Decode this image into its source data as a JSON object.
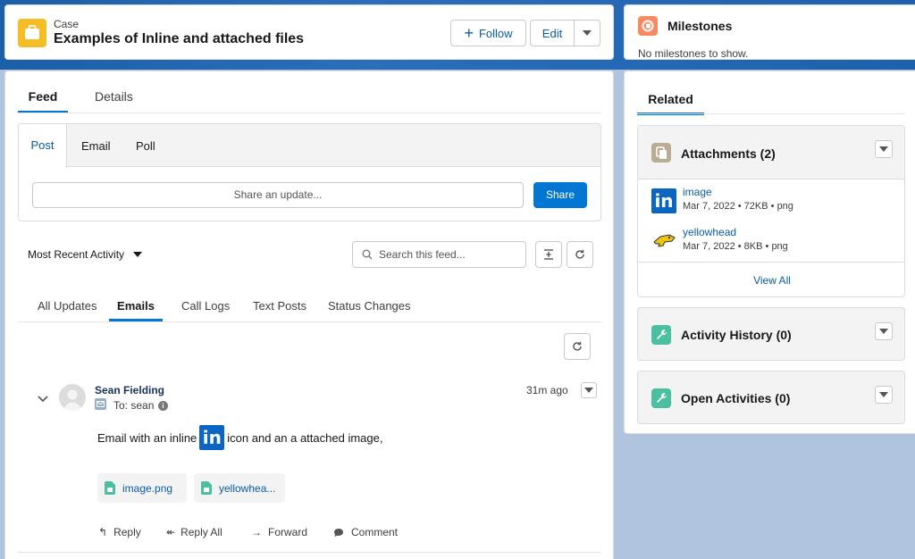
{
  "header": {
    "object_label": "Case",
    "title": "Examples of Inline and attached files",
    "follow_label": "Follow",
    "edit_label": "Edit"
  },
  "record_tabs": [
    {
      "label": "Feed",
      "active": true
    },
    {
      "label": "Details",
      "active": false
    }
  ],
  "publisher": {
    "tabs": [
      {
        "label": "Post",
        "active": true
      },
      {
        "label": "Email",
        "active": false
      },
      {
        "label": "Poll",
        "active": false
      }
    ],
    "share_placeholder": "Share an update...",
    "share_label": "Share"
  },
  "feed_controls": {
    "sort_label": "Most Recent Activity",
    "search_placeholder": "Search this feed..."
  },
  "feed_filters": [
    {
      "label": "All Updates",
      "active": false
    },
    {
      "label": "Emails",
      "active": true
    },
    {
      "label": "Call Logs",
      "active": false
    },
    {
      "label": "Text Posts",
      "active": false
    },
    {
      "label": "Status Changes",
      "active": false
    }
  ],
  "feed_item": {
    "author": "Sean Fielding",
    "to_text": "To: sean",
    "time": "31m ago",
    "body_before": "Email with an inline",
    "body_after": "icon and an a attached image,",
    "attachments": [
      "image.png",
      "yellowhea..."
    ],
    "actions": [
      "Reply",
      "Reply All",
      "Forward",
      "Comment"
    ]
  },
  "milestones": {
    "title": "Milestones",
    "empty_text": "No milestones to show."
  },
  "related": {
    "tab_label": "Related",
    "attachments": {
      "title": "Attachments (2)",
      "files": [
        {
          "name": "image",
          "date": "Mar 7, 2022",
          "size": "72KB",
          "type": "png"
        },
        {
          "name": "yellowhead",
          "date": "Mar 7, 2022",
          "size": "8KB",
          "type": "png"
        }
      ],
      "view_all": "View All"
    },
    "activity_history": {
      "title": "Activity History (0)"
    },
    "open_activities": {
      "title": "Open Activities (0)"
    }
  },
  "colors": {
    "brand": "#0176d3",
    "case_icon": "#f4bc25",
    "milestone_icon": "#f88962",
    "attachments_icon": "#baac93",
    "activity_icon": "#4bc0a1",
    "linkedin": "#0a66c2"
  }
}
